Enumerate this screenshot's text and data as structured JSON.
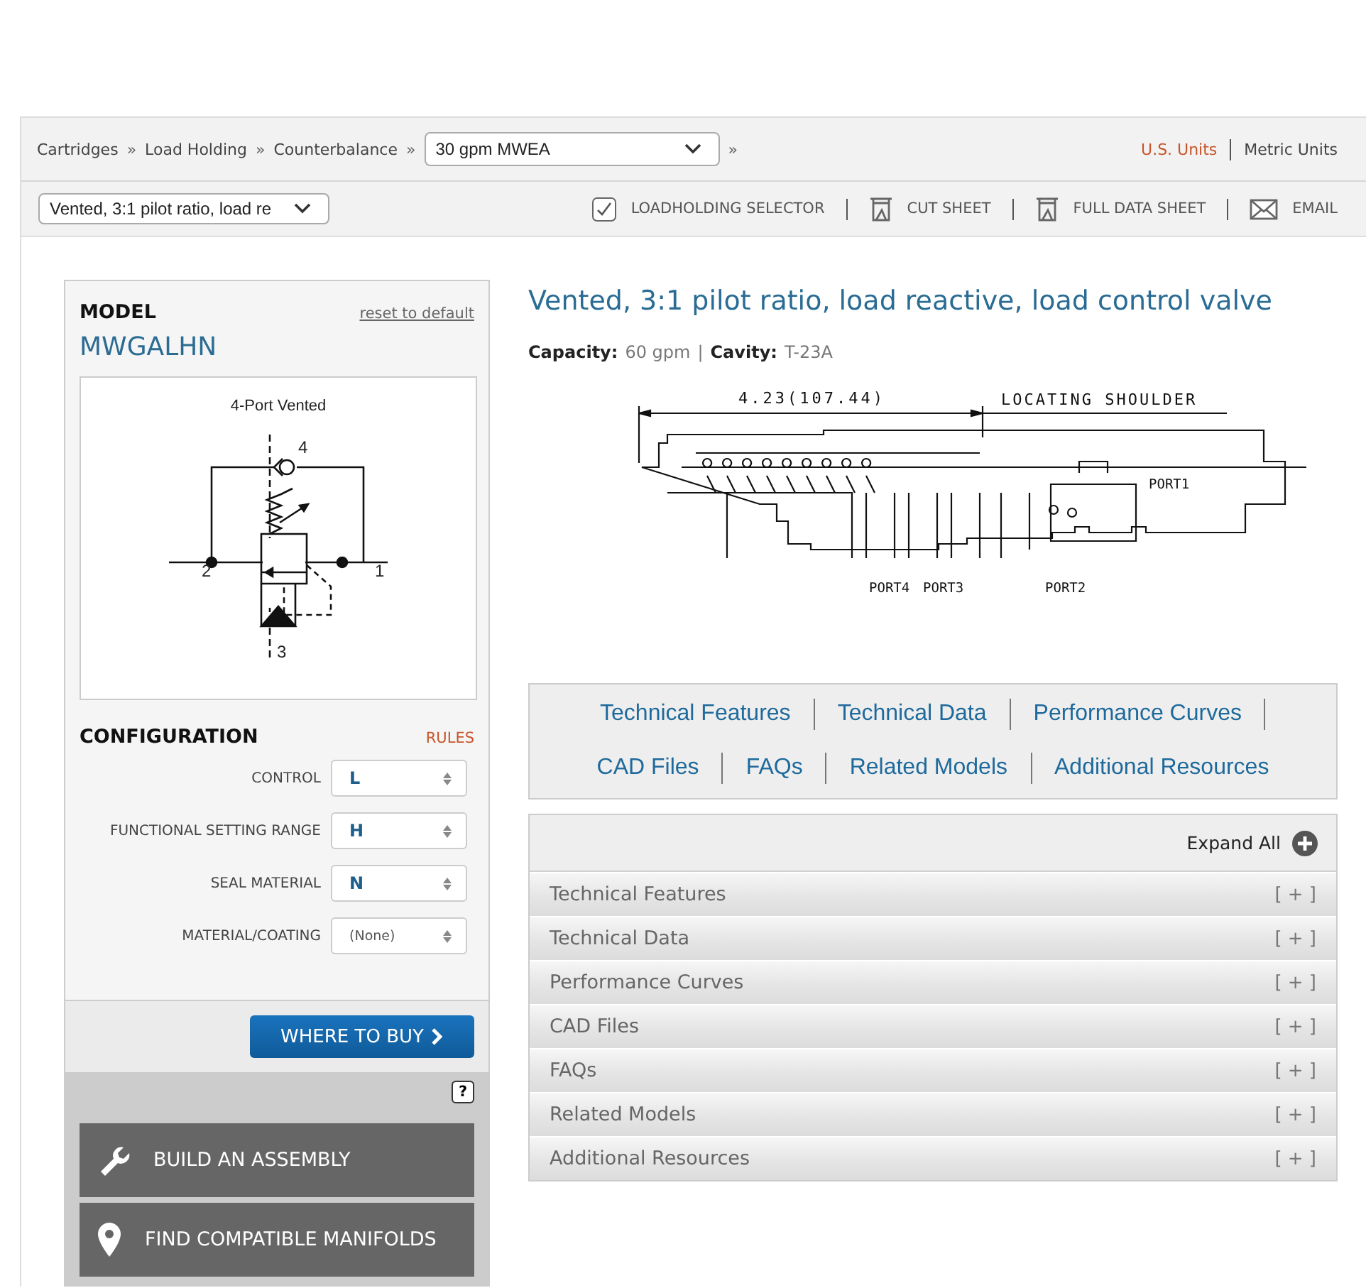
{
  "breadcrumb": {
    "items": [
      "Cartridges",
      "Load Holding",
      "Counterbalance"
    ],
    "separator": "»",
    "select_value": "30 gpm MWEA",
    "trailing": "»"
  },
  "units": [
    {
      "label": "U.S. Units",
      "selected": true
    },
    {
      "label": "Metric Units",
      "selected": false
    }
  ],
  "variant_select": {
    "value": "Vented, 3:1 pilot ratio, load re"
  },
  "toolbar": [
    {
      "kind": "check",
      "label": "LOADHOLDING SELECTOR"
    },
    {
      "kind": "sheet",
      "label": "CUT SHEET"
    },
    {
      "kind": "sheet",
      "label": "FULL DATA SHEET"
    },
    {
      "kind": "mail",
      "label": "EMAIL"
    }
  ],
  "model": {
    "heading": "MODEL",
    "reset": "reset to default",
    "code": "MWGALHN"
  },
  "schematic": {
    "title": "4-Port Vented",
    "ports": [
      "1",
      "2",
      "3",
      "4"
    ]
  },
  "configuration": {
    "heading": "CONFIGURATION",
    "rules": "RULES",
    "fields": [
      {
        "label": "CONTROL",
        "value": "L",
        "kind": "set"
      },
      {
        "label": "FUNCTIONAL SETTING RANGE",
        "value": "H",
        "kind": "set"
      },
      {
        "label": "SEAL MATERIAL",
        "value": "N",
        "kind": "set"
      },
      {
        "label": "MATERIAL/COATING",
        "value": "(None)",
        "kind": "default"
      }
    ]
  },
  "where_to_buy": "WHERE TO BUY",
  "help": "?",
  "actions": [
    {
      "kind": "wrench",
      "label": "BUILD AN ASSEMBLY"
    },
    {
      "kind": "pin",
      "label": "FIND COMPATIBLE MANIFOLDS"
    }
  ],
  "product": {
    "title": "Vented, 3:1 pilot ratio, load reactive, load control valve",
    "specs": [
      {
        "label": "Capacity:",
        "value": "60 gpm"
      },
      {
        "label": "Cavity:",
        "value": "T-23A"
      }
    ],
    "spec_separator": "|"
  },
  "cartridge_drawing": {
    "dimension": "4.23(107.44)",
    "shoulder": "LOCATING SHOULDER",
    "ports": [
      "PORT1",
      "PORT4",
      "PORT3",
      "PORT2"
    ]
  },
  "section_links": [
    "Technical Features",
    "Technical Data",
    "Performance Curves",
    "CAD Files",
    "FAQs",
    "Related Models",
    "Additional Resources"
  ],
  "accordion": {
    "expand_all": "Expand All",
    "sections": [
      {
        "title": "Technical Features",
        "toggle": "[ + ]"
      },
      {
        "title": "Technical Data",
        "toggle": "[ + ]"
      },
      {
        "title": "Performance Curves",
        "toggle": "[ + ]"
      },
      {
        "title": "CAD Files",
        "toggle": "[ + ]"
      },
      {
        "title": "FAQs",
        "toggle": "[ + ]"
      },
      {
        "title": "Related Models",
        "toggle": "[ + ]"
      },
      {
        "title": "Additional Resources",
        "toggle": "[ + ]"
      }
    ]
  }
}
